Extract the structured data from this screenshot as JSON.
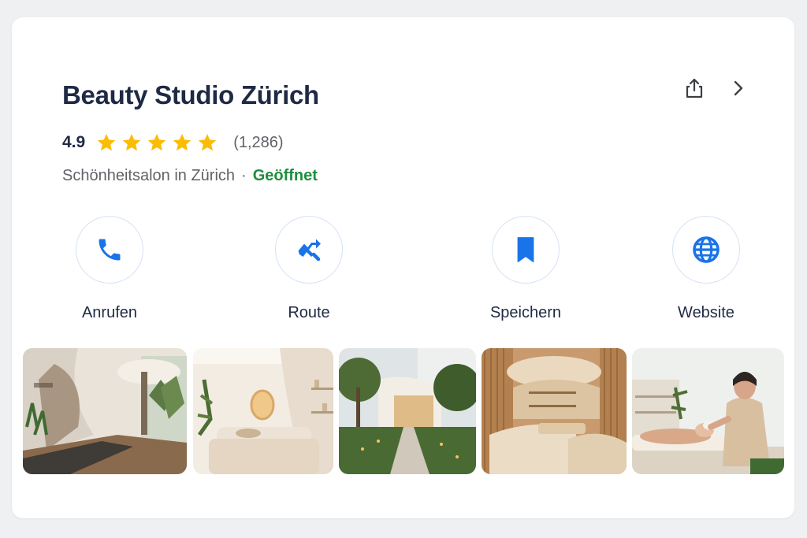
{
  "place": {
    "title": "Beauty Studio Zürich",
    "rating": "4.9",
    "stars": 5,
    "review_count": "(1,286)",
    "category": "Schönheitsalon in Zürich",
    "separator": "·",
    "status": "Geöffnet"
  },
  "top_actions": [
    {
      "icon": "share-icon"
    },
    {
      "icon": "chevron-right-icon"
    }
  ],
  "actions": [
    {
      "label": "Anrufen",
      "icon": "phone-icon"
    },
    {
      "label": "Route",
      "icon": "directions-icon"
    },
    {
      "label": "Speichern",
      "icon": "bookmark-icon"
    },
    {
      "label": "Website",
      "icon": "globe-icon"
    }
  ],
  "photos": [
    {
      "name": "photo-reception-lobby"
    },
    {
      "name": "photo-treatment-room"
    },
    {
      "name": "photo-garden-entrance"
    },
    {
      "name": "photo-wooden-lounge"
    },
    {
      "name": "photo-facial-treatment"
    }
  ],
  "colors": {
    "accent": "#1a73e8",
    "star": "#fbbc04",
    "open_status": "#1e8e3e",
    "title": "#1f2a44",
    "muted": "#5f6368"
  }
}
